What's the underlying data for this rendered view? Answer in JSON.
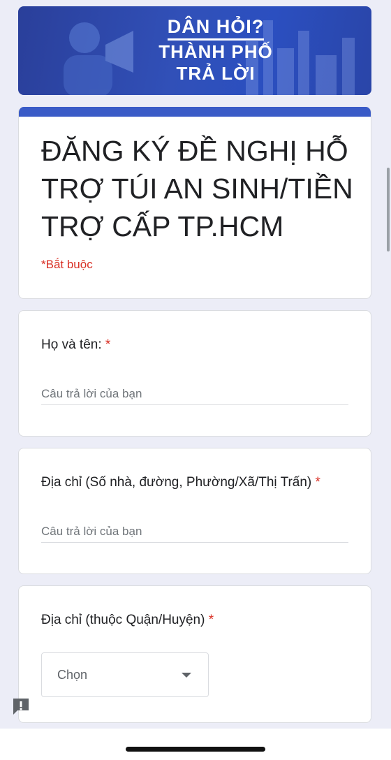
{
  "banner": {
    "line1": "DÂN HỎI?",
    "line2": "THÀNH PHỐ",
    "line3": "TRẢ LỜI"
  },
  "form": {
    "title": "ĐĂNG KÝ ĐỀ NGHỊ HỖ TRỢ TÚI AN SINH/TIỀN TRỢ CẤP TP.HCM",
    "required_note": "*Bắt buộc"
  },
  "questions": [
    {
      "label": "Họ và tên:",
      "required": "*",
      "placeholder": "Câu trả lời của bạn"
    },
    {
      "label": "Địa chỉ (Số nhà, đường, Phường/Xã/Thị Trấn)",
      "required": "*",
      "placeholder": "Câu trả lời của bạn"
    },
    {
      "label": "Địa chỉ (thuộc Quận/Huyện)",
      "required": "*",
      "select_value": "Chọn"
    }
  ],
  "icons": {
    "feedback": "report-feedback-icon",
    "dropdown": "caret-down-icon"
  },
  "colors": {
    "accent": "#3a5bc7",
    "required": "#d93025",
    "background": "#ecedf7"
  }
}
